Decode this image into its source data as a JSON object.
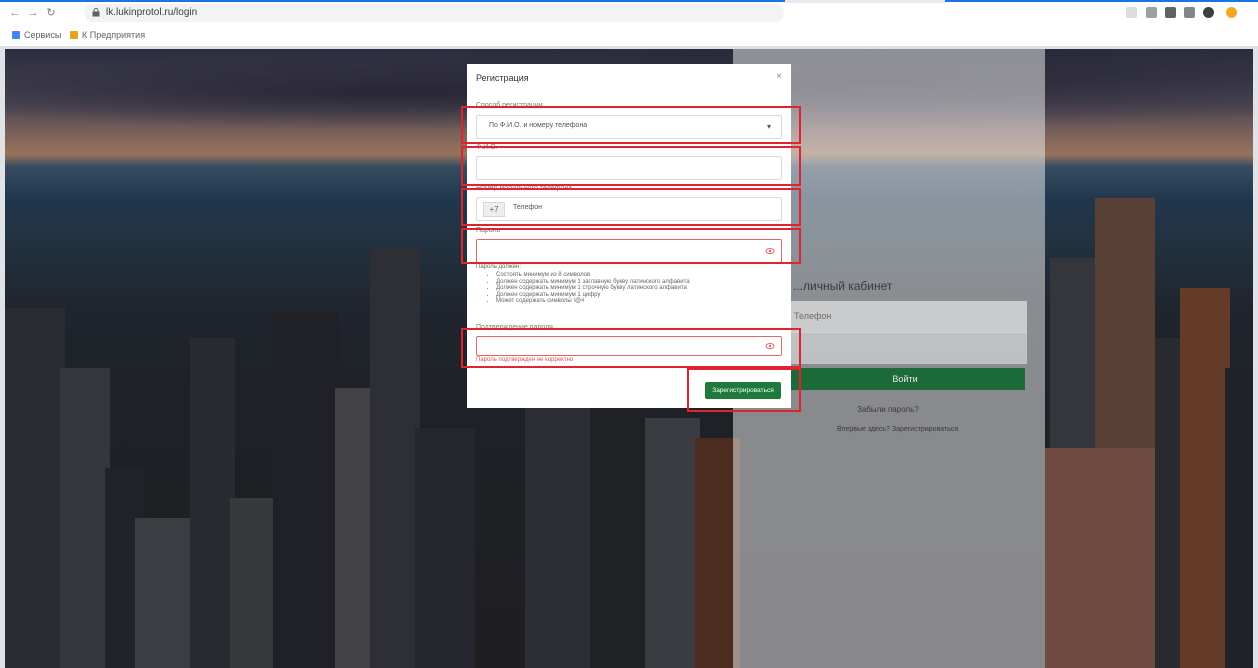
{
  "browser": {
    "url": "lk.lukinprotol.ru/login",
    "bookmarks": [
      "Сервисы",
      "К Предприятия"
    ]
  },
  "login_panel": {
    "title": "...личный кабинет",
    "phone_placeholder": "Телефон",
    "login_button": "Войти",
    "forgot_link": "Забыли пароль?",
    "register_link": "Впервые здесь? Зарегистрироваться"
  },
  "modal": {
    "title": "Регистрация",
    "close_symbol": "×",
    "fields": [
      {
        "label": "Способ регистрации",
        "value": "По Ф.И.О. и номеру телефона"
      },
      {
        "label": "Ф.И.О.",
        "value": ""
      },
      {
        "label": "Номер мобильного телефона",
        "prefix": "+7",
        "value": "Телефон"
      },
      {
        "label": "Пароль",
        "value": ""
      },
      {
        "label": "Подтверждение пароля",
        "value": ""
      }
    ],
    "password_rules_title": "Пароль должен:",
    "password_rules": [
      "Состоять минимум из 8 символов",
      "Должен содержать минимум 1 заглавную букву латинского алфавита",
      "Должен содержать минимум 1 строчную букву латинского алфавита",
      "Должен содержать минимум 1 цифру",
      "Может содержать символы !@#"
    ],
    "confirm_error": "Пароль подтвержден не корректно",
    "submit_button": "Зарегистрироваться"
  },
  "colors": {
    "accent_green": "#1e7a3a",
    "annotation_red": "#e0232f"
  }
}
